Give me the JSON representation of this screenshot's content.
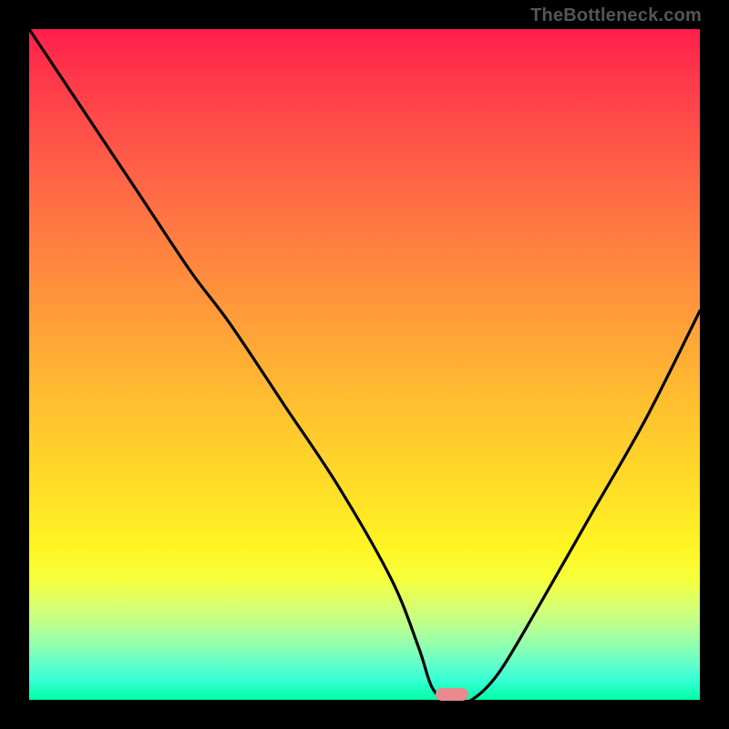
{
  "watermark": "TheBottleneck.com",
  "marker": {
    "x_pct": 63,
    "y_pct": 99.2
  },
  "chart_data": {
    "type": "line",
    "title": "",
    "xlabel": "",
    "ylabel": "",
    "xlim": [
      0,
      100
    ],
    "ylim": [
      0,
      100
    ],
    "grid": false,
    "legend": false,
    "series": [
      {
        "name": "bottleneck-curve",
        "x": [
          0,
          8,
          16,
          24,
          30,
          38,
          46,
          54,
          58,
          60,
          62,
          64,
          66,
          70,
          76,
          84,
          92,
          100
        ],
        "y": [
          100,
          88,
          76,
          64,
          56,
          44,
          32,
          18,
          8,
          2,
          0,
          0,
          0,
          4,
          14,
          28,
          42,
          58
        ]
      }
    ],
    "annotations": [
      {
        "type": "marker",
        "x": 63,
        "y": 0.8,
        "shape": "pill",
        "color": "#e88a8f"
      }
    ],
    "background_gradient": {
      "direction": "vertical",
      "stops": [
        {
          "pos": 0,
          "color": "#ff1f4b"
        },
        {
          "pos": 50,
          "color": "#ffbd30"
        },
        {
          "pos": 80,
          "color": "#fff423"
        },
        {
          "pos": 100,
          "color": "#00ffa6"
        }
      ]
    }
  }
}
